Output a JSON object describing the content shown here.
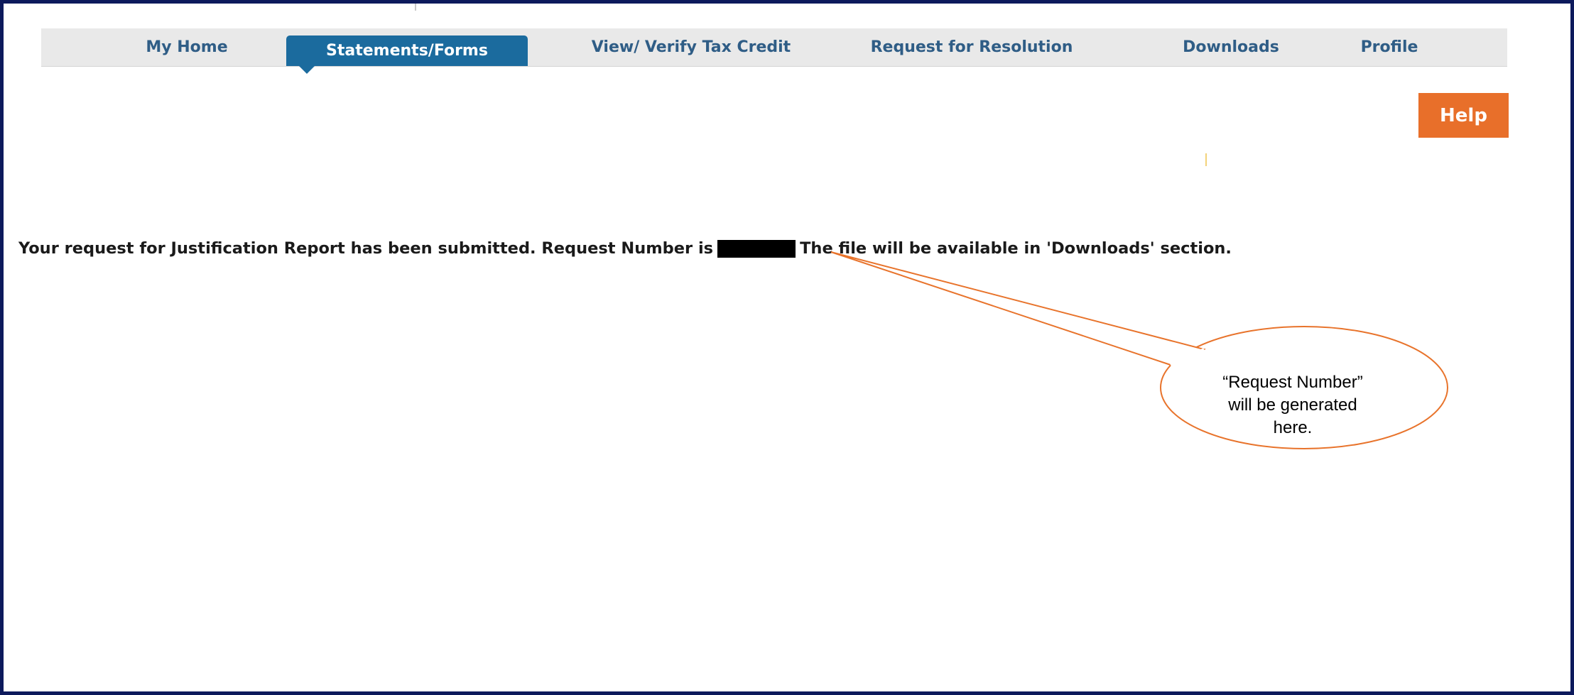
{
  "nav": {
    "tabs": [
      {
        "label": "My Home",
        "active": false
      },
      {
        "label": "Statements/Forms",
        "active": true
      },
      {
        "label": "View/ Verify Tax Credit",
        "active": false
      },
      {
        "label": "Request for Resolution",
        "active": false
      },
      {
        "label": "Downloads",
        "active": false
      },
      {
        "label": "Profile",
        "active": false
      }
    ]
  },
  "help": {
    "label": "Help"
  },
  "message": {
    "before": "Your request for Justification Report has been submitted. Request Number is",
    "after": "The file will be available in 'Downloads' section."
  },
  "callout": {
    "lines": [
      "“Request Number”",
      "will be generated",
      "here."
    ]
  },
  "colors": {
    "frame_border": "#0d1a5c",
    "nav_background": "#e9e9e9",
    "active_tab": "#1b6b9e",
    "tab_text": "#2f5d86",
    "help_button": "#e86f2a",
    "callout_stroke": "#e8732b"
  }
}
